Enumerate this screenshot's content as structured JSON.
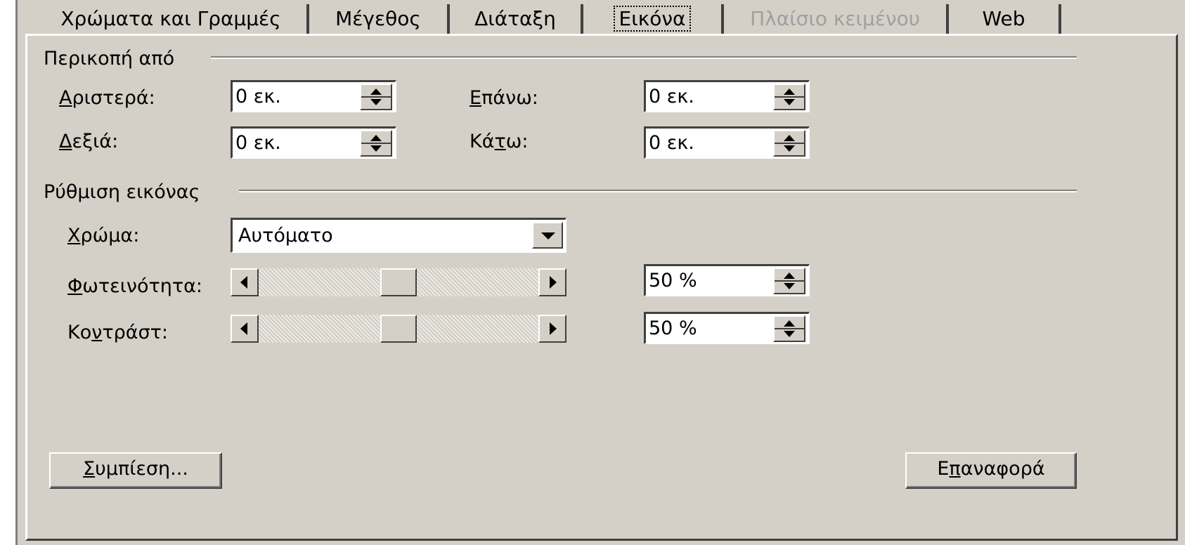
{
  "tabs": [
    {
      "label": "Χρώματα και Γραμμές",
      "state": "normal"
    },
    {
      "label": "Μέγεθος",
      "state": "normal"
    },
    {
      "label": "Διάταξη",
      "state": "normal"
    },
    {
      "label": "Εικόνα",
      "state": "active"
    },
    {
      "label": "Πλαίσιο κειμένου",
      "state": "disabled"
    },
    {
      "label": "Web",
      "state": "normal"
    }
  ],
  "crop": {
    "title": "Περικοπή από",
    "left": {
      "label_key": "Α",
      "label_rest": "ριστερά:",
      "value": "0 εκ."
    },
    "top": {
      "label_key": "Ε",
      "label_rest": "πάνω:",
      "value": "0 εκ."
    },
    "right": {
      "label_key": "Δ",
      "label_rest": "εξιά:",
      "value": "0 εκ."
    },
    "bottom": {
      "label_pre": "Κά",
      "label_key": "τ",
      "label_rest": "ω:",
      "value": "0 εκ."
    }
  },
  "image_control": {
    "title": "Ρύθμιση εικόνας",
    "color": {
      "label_key": "Χ",
      "label_rest": "ρώμα:",
      "value": "Αυτόματο"
    },
    "brightness": {
      "label_key": "Φ",
      "label_rest": "ωτεινότητα:",
      "value": "50 %",
      "level": 0.5
    },
    "contrast": {
      "label_pre": "Κο",
      "label_key": "ν",
      "label_rest": "τράστ:",
      "value": "50 %",
      "level": 0.5
    }
  },
  "buttons": {
    "compress": {
      "label_key": "Σ",
      "label_rest": "υμπίεση..."
    },
    "reset": {
      "label_pre": "Ε",
      "label_key": "π",
      "label_rest": "αναφορά"
    }
  },
  "colors": {
    "face": "#d4d0c8",
    "shadow": "#404040",
    "highlight": "#ffffff",
    "disabled_text": "#a0a0a0"
  }
}
